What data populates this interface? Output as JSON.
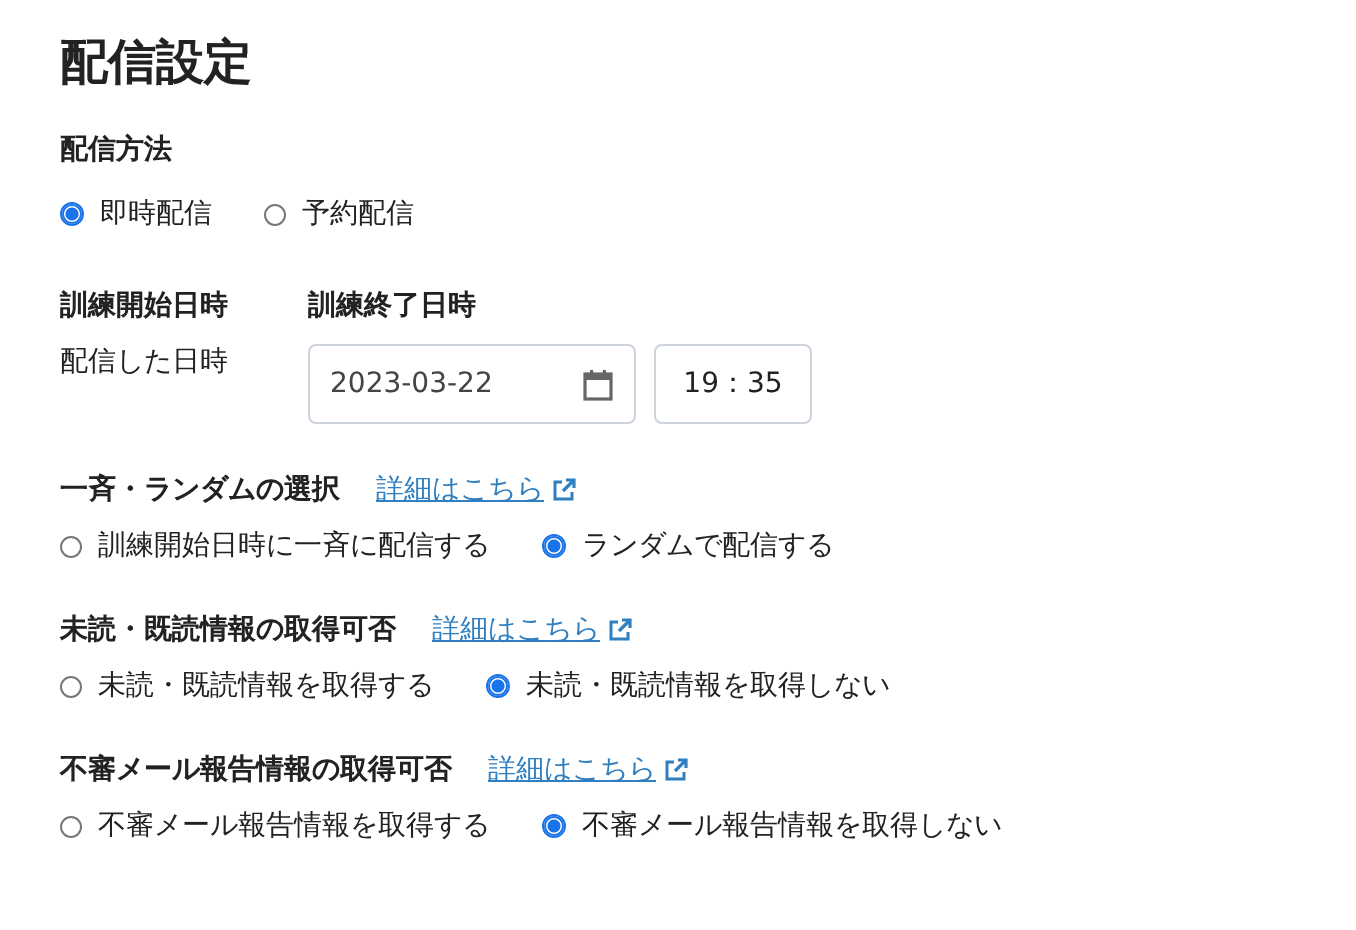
{
  "title": "配信設定",
  "delivery_method": {
    "label": "配信方法",
    "options": [
      {
        "label": "即時配信",
        "selected": true
      },
      {
        "label": "予約配信",
        "selected": false
      }
    ]
  },
  "schedule": {
    "start": {
      "label": "訓練開始日時",
      "value": "配信した日時"
    },
    "end": {
      "label": "訓練終了日時",
      "date": "2023-03-22",
      "time": "19：35"
    }
  },
  "sections": [
    {
      "label": "一斉・ランダムの選択",
      "link": "詳細はこちら",
      "options": [
        {
          "label": "訓練開始日時に一斉に配信する",
          "selected": false
        },
        {
          "label": "ランダムで配信する",
          "selected": true
        }
      ]
    },
    {
      "label": "未読・既読情報の取得可否",
      "link": "詳細はこちら",
      "options": [
        {
          "label": "未読・既読情報を取得する",
          "selected": false
        },
        {
          "label": "未読・既読情報を取得しない",
          "selected": true
        }
      ]
    },
    {
      "label": "不審メール報告情報の取得可否",
      "link": "詳細はこちら",
      "options": [
        {
          "label": "不審メール報告情報を取得する",
          "selected": false
        },
        {
          "label": "不審メール報告情報を取得しない",
          "selected": true
        }
      ]
    }
  ]
}
